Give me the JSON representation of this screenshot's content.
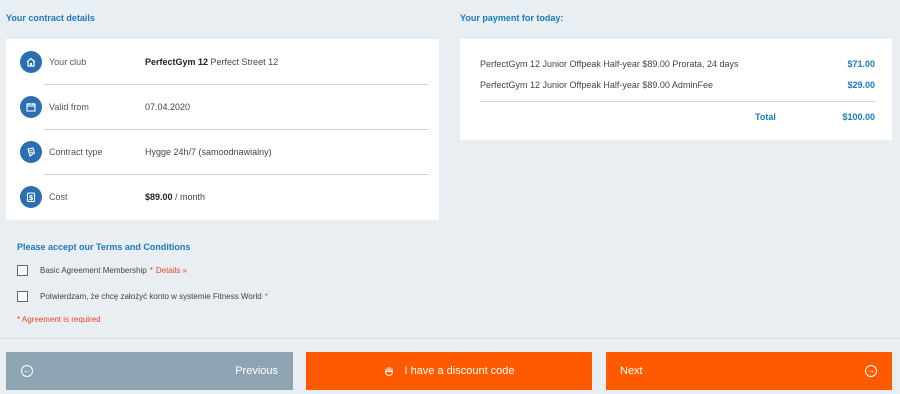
{
  "contract": {
    "title": "Your contract details",
    "rows": [
      {
        "icon": "house-icon",
        "label": "Your club",
        "value_bold": "PerfectGym 12",
        "value": " Perfect Street 12"
      },
      {
        "icon": "calendar-icon",
        "label": "Valid from",
        "value_bold": "",
        "value": "07.04.2020"
      },
      {
        "icon": "contract-icon",
        "label": "Contract type",
        "value_bold": "",
        "value": "Hygge 24h/7 (samoodnawialny)"
      },
      {
        "icon": "dollar-icon",
        "label": "Cost",
        "value_bold": "$89.00",
        "value": " / month"
      }
    ]
  },
  "payment": {
    "title": "Your payment for today:",
    "lines": [
      {
        "description": "PerfectGym 12 Junior Offpeak Half-year $89.00 Prorata, 24 days",
        "amount": "$71.00"
      },
      {
        "description": "PerfectGym 12 Junior Offpeak Half-year $89.00 AdminFee",
        "amount": "$29.00"
      }
    ],
    "total_label": "Total",
    "total_amount": "$100.00"
  },
  "terms": {
    "title": "Please accept our Terms and Conditions",
    "agreements": [
      {
        "label": "Basic Agreement Membership",
        "required_mark": "*",
        "link": "Details »",
        "checked": false
      },
      {
        "label": "Potwierdzam, że chcę założyć konto w systemie Fitness World",
        "required_mark": "*",
        "checked": false
      }
    ],
    "required_note": "* Agreement is required"
  },
  "buttons": {
    "previous": "Previous",
    "discount": "I have a discount code",
    "next": "Next"
  },
  "colors": {
    "accent_blue": "#1a7bbf",
    "icon_blue": "#2a6fb0",
    "orange": "#ff5a00",
    "disabled_gray": "#8fa4b2",
    "required_red": "#e8472b"
  }
}
